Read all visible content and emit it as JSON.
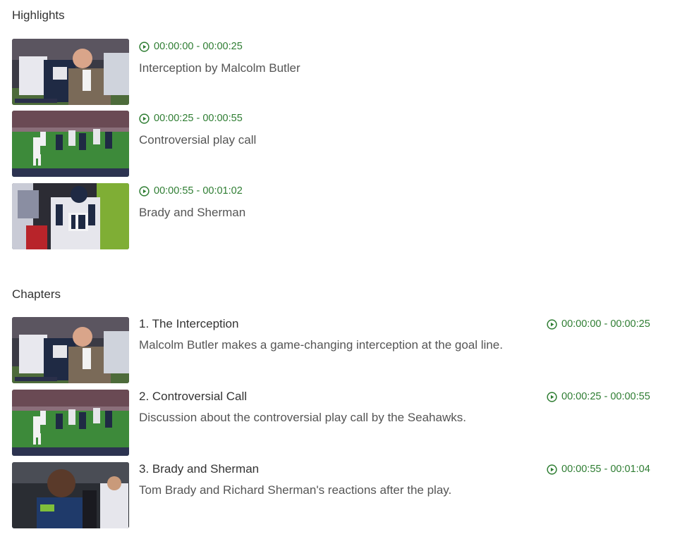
{
  "highlights": {
    "heading": "Highlights",
    "items": [
      {
        "time": "00:00:00 - 00:00:25",
        "title": "Interception by Malcolm Butler"
      },
      {
        "time": "00:00:25 - 00:00:55",
        "title": "Controversial play call"
      },
      {
        "time": "00:00:55 - 00:01:02",
        "title": "Brady and Sherman"
      }
    ]
  },
  "chapters": {
    "heading": "Chapters",
    "items": [
      {
        "title": "1. The Interception",
        "description": "Malcolm Butler makes a game-changing interception at the goal line.",
        "time": "00:00:00 - 00:00:25"
      },
      {
        "title": "2. Controversial Call",
        "description": "Discussion about the controversial play call by the Seahawks.",
        "time": "00:00:25 - 00:00:55"
      },
      {
        "title": "3. Brady and Sherman",
        "description": "Tom Brady and Richard Sherman's reactions after the play.",
        "time": "00:00:55 - 00:01:04"
      }
    ]
  },
  "icons": {
    "timestamp": "play-circle-icon"
  },
  "colors": {
    "timestamp": "#2e7d32",
    "text": "#555555",
    "heading": "#333333"
  }
}
